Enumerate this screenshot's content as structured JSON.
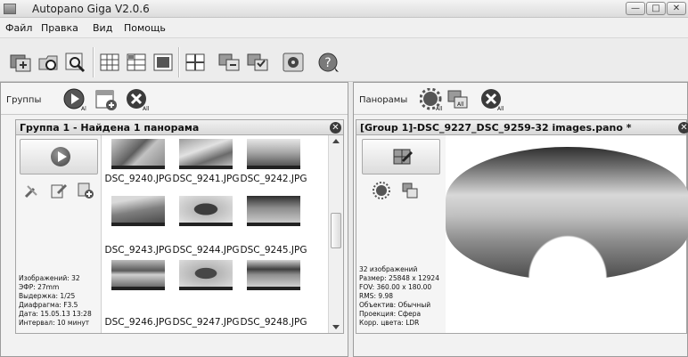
{
  "window": {
    "title": "Autopano Giga V2.0.6",
    "controls": [
      "—",
      "□",
      "✕"
    ]
  },
  "menu": [
    "Файл",
    "Правка",
    "Вид",
    "Помощь"
  ],
  "toolbar": {
    "icons": [
      "import-icon",
      "open-folder-icon",
      "search-icon",
      "grid-view-icon",
      "list-view-icon",
      "image-view-icon",
      "export-icon",
      "batch-export-icon",
      "settings-icon",
      "help-icon"
    ]
  },
  "left_panel": {
    "header_label": "Группы",
    "group": {
      "title": "Группа 1 - Найдена 1 панорама",
      "info": [
        "Изображений: 32",
        "ЭФР: 27mm",
        "Выдержка: 1/25",
        "Диафрагма: F3.5",
        "Дата: 15.05.13 13:28",
        "Интервал: 10 минут"
      ],
      "thumbnails": [
        "DSC_9240.JPG",
        "DSC_9241.JPG",
        "DSC_9242.JPG",
        "DSC_9243.JPG",
        "DSC_9244.JPG",
        "DSC_9245.JPG",
        "DSC_9246.JPG",
        "DSC_9247.JPG",
        "DSC_9248.JPG"
      ]
    }
  },
  "right_panel": {
    "header_label": "Панорамы",
    "pano": {
      "title": "[Group 1]-DSC_9227_DSC_9259-32 images.pano *",
      "info": [
        "32 изображений",
        "Размер: 25848 x 12924",
        "FOV: 360.00 x 180.00",
        "RMS: 9.98",
        "Объектив: Обычный",
        "Проекция: Сфера",
        "Корр. цвета: LDR"
      ]
    }
  }
}
